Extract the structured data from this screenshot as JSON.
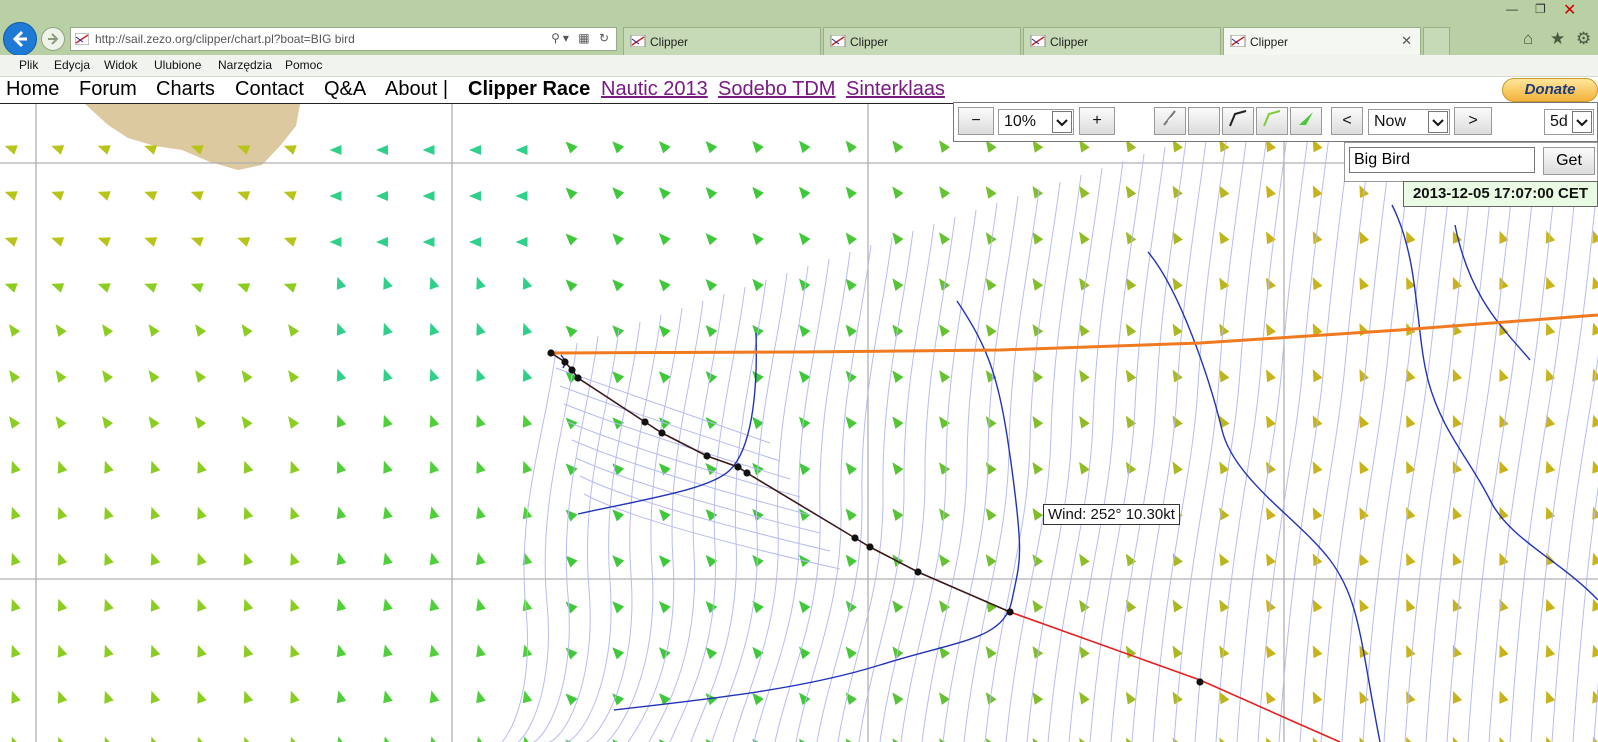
{
  "browser": {
    "url": "http://sail.zezo.org/clipper/chart.pl?boat=BIG bird",
    "tabs": [
      {
        "label": "Clipper",
        "active": false
      },
      {
        "label": "Clipper",
        "active": false
      },
      {
        "label": "Clipper",
        "active": false
      },
      {
        "label": "Clipper",
        "active": true
      }
    ],
    "menu": [
      "Plik",
      "Edycja",
      "Widok",
      "Ulubione",
      "Narzędzia",
      "Pomoc"
    ],
    "accent_color": "#1f7ad6"
  },
  "site_nav": {
    "links": [
      "Home",
      "Forum",
      "Charts",
      "Contact",
      "Q&A",
      "About |"
    ],
    "brand": "Clipper Race",
    "external_links": [
      "Nautic 2013",
      "Sodebo TDM",
      "Sinterklaas"
    ],
    "donate_label": "Donate"
  },
  "toolbar": {
    "zoom_out": "−",
    "zoom_value": "10%",
    "zoom_in": "+",
    "prev": "<",
    "time_value": "Now",
    "next": ">",
    "period_value": "5d"
  },
  "boat": {
    "input_value": "Big Bird",
    "get_label": "Get",
    "timestamp": "2013-12-05 17:07:00 CET"
  },
  "map": {
    "wind_tooltip": "Wind: 252° 10.30kt",
    "colors": {
      "route": "#f07a1f",
      "track": "#e82020",
      "isochrone": "#b8bcf0",
      "isoline": "#2233bb",
      "land": "#dcc9a0"
    }
  }
}
